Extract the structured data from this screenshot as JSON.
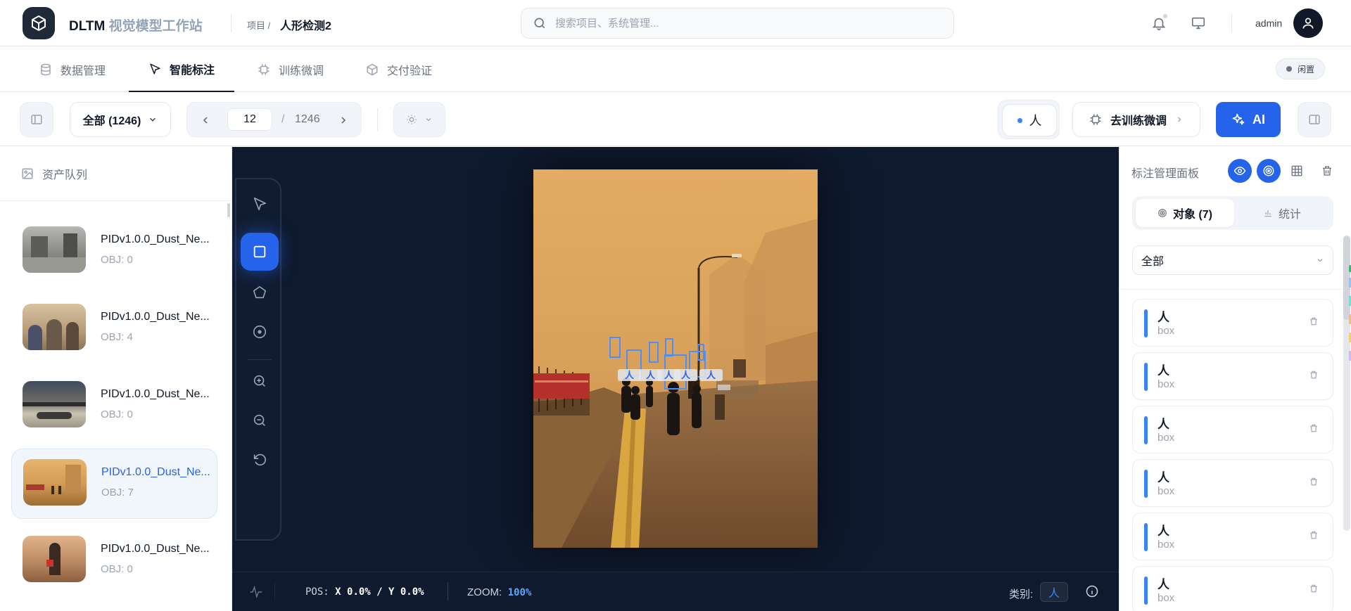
{
  "app": {
    "brand_main": "DLTM",
    "brand_sub": "视觉模型工作站",
    "breadcrumb_prefix": "项目 /",
    "breadcrumb_current": "人形检测2",
    "search_placeholder": "搜索项目、系统管理...",
    "user_name": "admin"
  },
  "tabs": [
    {
      "label": "数据管理",
      "icon": "database-icon"
    },
    {
      "label": "智能标注",
      "icon": "pointer-icon",
      "active": true
    },
    {
      "label": "训练微调",
      "icon": "cpu-icon"
    },
    {
      "label": "交付验证",
      "icon": "cube-icon"
    }
  ],
  "status_badge": "闲置",
  "toolbar": {
    "filter_label": "全部 (1246)",
    "current_page": "12",
    "page_separator": "/",
    "total_pages": "1246",
    "active_class": "人",
    "train_button": "去训练微调",
    "ai_button": "AI"
  },
  "queue": {
    "title": "资产队列",
    "items": [
      {
        "name": "PIDv1.0.0_Dust_Ne...",
        "obj": "OBJ: 0",
        "thumb": "#8a8a86"
      },
      {
        "name": "PIDv1.0.0_Dust_Ne...",
        "obj": "OBJ: 4",
        "thumb": "#b59a78"
      },
      {
        "name": "PIDv1.0.0_Dust_Ne...",
        "obj": "OBJ: 0",
        "thumb": "#6f6d66"
      },
      {
        "name": "PIDv1.0.0_Dust_Ne...",
        "obj": "OBJ: 7",
        "thumb": "#d39a54",
        "selected": true
      },
      {
        "name": "PIDv1.0.0_Dust_Ne...",
        "obj": "OBJ: 0",
        "thumb": "#b88660"
      }
    ]
  },
  "canvas": {
    "label_text": "人"
  },
  "statusbar": {
    "pos_label": "POS:",
    "pos_value": "X 0.0% / Y 0.0%",
    "zoom_label": "ZOOM:",
    "zoom_value": "100%",
    "class_label": "类别:",
    "class_value": "人"
  },
  "panel": {
    "title": "标注管理面板",
    "tab_objects": "对象 (7)",
    "tab_stats": "统计",
    "filter": "全部",
    "objects": [
      {
        "cls": "人",
        "type": "box"
      },
      {
        "cls": "人",
        "type": "box"
      },
      {
        "cls": "人",
        "type": "box"
      },
      {
        "cls": "人",
        "type": "box"
      },
      {
        "cls": "人",
        "type": "box"
      },
      {
        "cls": "人",
        "type": "box"
      }
    ]
  },
  "colors": {
    "accent": "#2563eb",
    "canvas_bg": "#0f1a2e",
    "bbox": "#4f8ef7"
  }
}
